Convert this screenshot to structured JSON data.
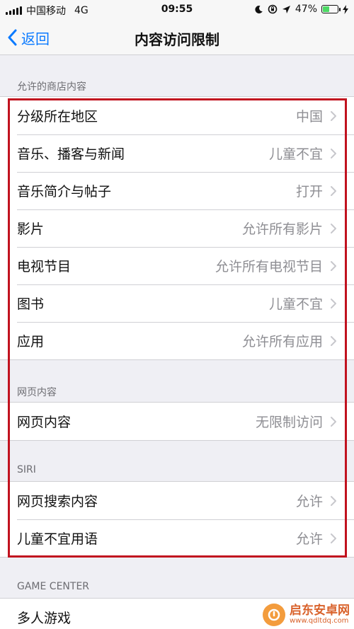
{
  "status_bar": {
    "carrier": "中国移动",
    "network": "4G",
    "time": "09:55",
    "battery": "47%",
    "battery_level": 0.47,
    "icons": [
      "moon-icon",
      "orientation-lock-icon",
      "location-icon",
      "battery-icon",
      "charging-icon"
    ]
  },
  "nav": {
    "back_label": "返回",
    "title": "内容访问限制"
  },
  "sections": [
    {
      "header": "允许的商店内容",
      "rows": [
        {
          "label": "分级所在地区",
          "value": "中国"
        },
        {
          "label": "音乐、播客与新闻",
          "value": "儿童不宜"
        },
        {
          "label": "音乐简介与帖子",
          "value": "打开"
        },
        {
          "label": "影片",
          "value": "允许所有影片"
        },
        {
          "label": "电视节目",
          "value": "允许所有电视节目"
        },
        {
          "label": "图书",
          "value": "儿童不宜"
        },
        {
          "label": "应用",
          "value": "允许所有应用"
        }
      ]
    },
    {
      "header": "网页内容",
      "rows": [
        {
          "label": "网页内容",
          "value": "无限制访问"
        }
      ]
    },
    {
      "header": "SIRI",
      "rows": [
        {
          "label": "网页搜索内容",
          "value": "允许"
        },
        {
          "label": "儿童不宜用语",
          "value": "允许"
        }
      ]
    },
    {
      "header": "GAME CENTER",
      "rows": [
        {
          "label": "多人游戏",
          "value": ""
        }
      ]
    }
  ],
  "watermark": {
    "text": "启东安卓网",
    "url": "www.qdltdq.com"
  },
  "colors": {
    "accent": "#0a7aff",
    "highlight": "#c1121f",
    "battery": "#4cd964"
  }
}
